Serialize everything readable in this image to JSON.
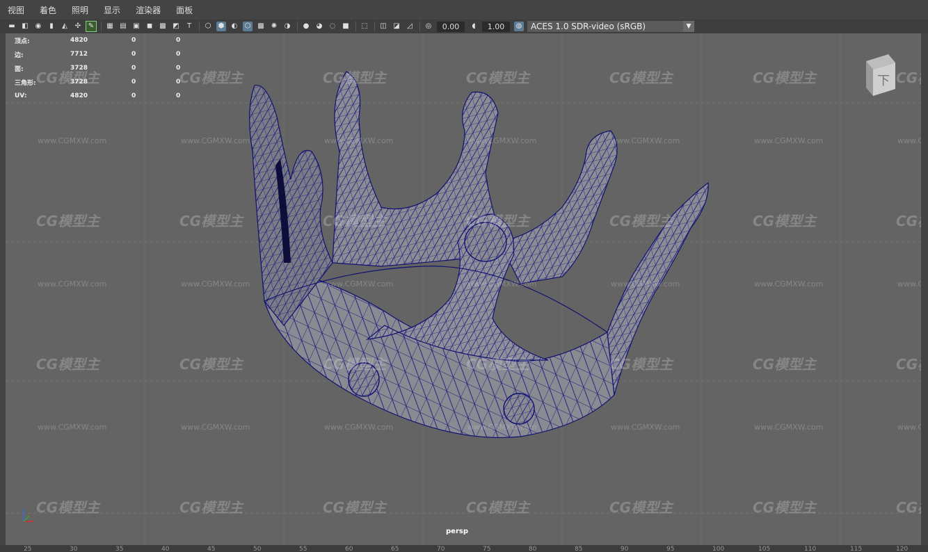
{
  "menu": [
    "视图",
    "着色",
    "照明",
    "显示",
    "渲染器",
    "面板"
  ],
  "toolbar": {
    "icons": [
      "camera-icon",
      "camera-attr-icon",
      "bookmark-icon",
      "snapshot-icon",
      "image-plane-icon",
      "grease-pencil-icon",
      "pivot-icon",
      "edit-icon",
      "grid-icon",
      "film-gate-icon",
      "resolution-gate-icon",
      "gate-mask-icon",
      "field-chart-icon",
      "safe-action-icon",
      "safe-title-icon",
      "wireframe-icon",
      "smooth-shade-icon",
      "wireframe-on-shaded-icon",
      "textured-icon",
      "lights-icon",
      "shadows-icon",
      "ambient-occlusion-icon",
      "motion-blur-icon",
      "anti-alias-icon",
      "depth-of-field-icon",
      "isolate-select-icon",
      "xray-icon",
      "xray-joints-icon",
      "xray-components-icon"
    ],
    "exposure": "0.00",
    "gamma": "1.00",
    "color_space": "ACES 1.0 SDR-video (sRGB)"
  },
  "hud": [
    {
      "label": "顶点:",
      "v1": "4820",
      "v2": "0",
      "v3": "0"
    },
    {
      "label": "边:",
      "v1": "7712",
      "v2": "0",
      "v3": "0"
    },
    {
      "label": "面:",
      "v1": "3728",
      "v2": "0",
      "v3": "0"
    },
    {
      "label": "三角形:",
      "v1": "3728",
      "v2": "0",
      "v3": "0"
    },
    {
      "label": "UV:",
      "v1": "4820",
      "v2": "0",
      "v3": "0"
    }
  ],
  "camera_label": "persp",
  "viewcube_label": "下",
  "watermark": "CG模型主",
  "watermark_url": "www.CGMXW.com",
  "ruler_ticks": [
    "25",
    "30",
    "35",
    "40",
    "45",
    "50",
    "55",
    "60",
    "65",
    "70",
    "75",
    "80",
    "85",
    "90",
    "95",
    "100",
    "105",
    "110",
    "115",
    "120"
  ]
}
